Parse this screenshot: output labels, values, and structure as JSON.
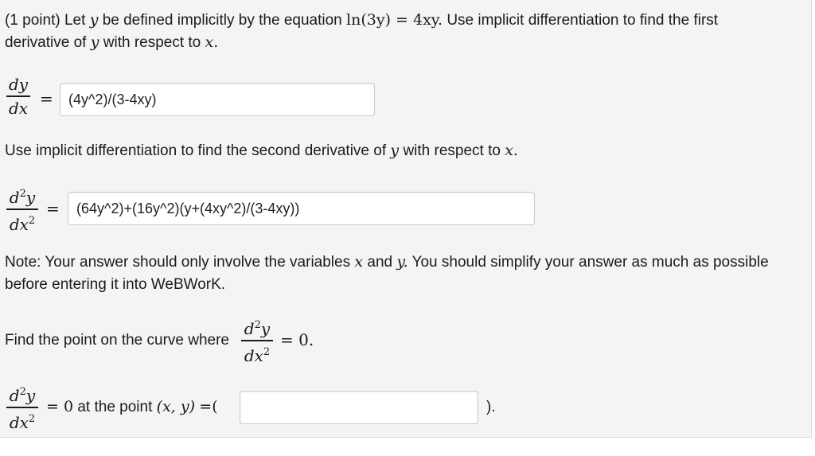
{
  "problem": {
    "points": "(1 point)",
    "intro_text": "Let",
    "var_y": "y",
    "intro_text2": "be defined implicitly by the equation",
    "equation": "ln(3y) = 4xy.",
    "intro_text3": "Use implicit differentiation to find the first",
    "line2_text": "derivative of",
    "line2_var_y": "y",
    "line2_text2": "with respect to",
    "line2_var_x": "x."
  },
  "first_derivative": {
    "numerator": "dy",
    "denominator": "dx",
    "equals": "=",
    "answer_value": "(4y^2)/(3-4xy)"
  },
  "second_prompt": {
    "text": "Use implicit differentiation to find the second derivative of",
    "var_y": "y",
    "text2": "with respect to",
    "var_x": "x."
  },
  "second_derivative": {
    "numerator": "d",
    "numerator_sup": "2",
    "numerator_var": "y",
    "denominator": "dx",
    "denominator_sup": "2",
    "equals": "=",
    "answer_value": "(64y^2)+(16y^2)(y+(4xy^2)/(3-4xy))"
  },
  "note": {
    "line1_text": "Note: Your answer should only involve the variables",
    "var_x": "x",
    "and": "and",
    "var_y": "y.",
    "line1_text2": "You should simplify your answer as much as possible",
    "line2_text": "before entering it into WeBWorK."
  },
  "find_point": {
    "text": "Find the point on the curve where",
    "numerator": "d",
    "numerator_sup": "2",
    "numerator_var": "y",
    "denominator": "dx",
    "denominator_sup": "2",
    "equals_zero": "= 0."
  },
  "point_answer": {
    "numerator": "d",
    "numerator_sup": "2",
    "numerator_var": "y",
    "denominator": "dx",
    "denominator_sup": "2",
    "equals_zero": "= 0",
    "at_text": "at the point",
    "coords": "(x, y)",
    "eq_open": "=(",
    "answer_value": "",
    "close": ")."
  }
}
